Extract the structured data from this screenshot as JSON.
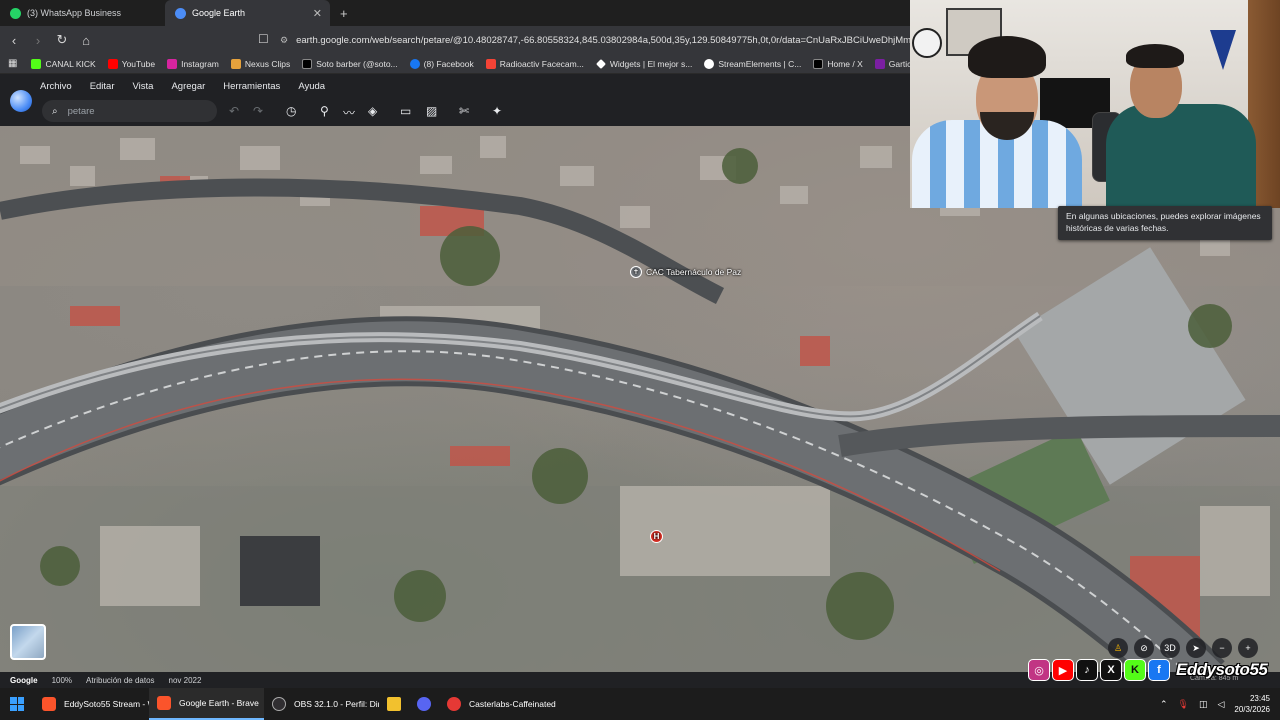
{
  "browser": {
    "tabs": [
      {
        "label": "(3) WhatsApp Business",
        "icon": "whatsapp-icon",
        "active": false
      },
      {
        "label": "Google Earth",
        "icon": "google-earth-icon",
        "active": true
      }
    ],
    "url": "earth.google.com/web/search/petare/@10.48028747,-66.80558324,845.03802984a,500d,35y,129.50849775h,0t,0r/data=CnUaRxJBCiUweDhjMm...",
    "bookmarks": [
      {
        "label": "CANAL KICK",
        "color": "#53fc18"
      },
      {
        "label": "YouTube",
        "color": "#ff0000"
      },
      {
        "label": "Instagram",
        "color": "#d6249f"
      },
      {
        "label": "Nexus Clips",
        "color": "#e6a23c"
      },
      {
        "label": "Soto barber (@soto...",
        "color": "#000000"
      },
      {
        "label": "(8) Facebook",
        "color": "#1877f2"
      },
      {
        "label": "Radioactiv Facecam...",
        "color": "#f44336"
      },
      {
        "label": "Widgets | El mejor s...",
        "color": "#ffffff"
      },
      {
        "label": "StreamElements | C...",
        "color": "#ffffff"
      },
      {
        "label": "Home / X",
        "color": "#000000"
      },
      {
        "label": "Gartic Phone - Tele",
        "color": "#7b1fa2"
      }
    ]
  },
  "earth": {
    "menu": [
      "Archivo",
      "Editar",
      "Vista",
      "Agregar",
      "Herramientas",
      "Ayuda"
    ],
    "search_placeholder": "petare",
    "poi_label": "CAC Tabernáculo de Paz",
    "tooltip": "En algunas ubicaciones, puedes explorar imágenes históricas de varias fechas.",
    "controls": {
      "three_d": "3D"
    },
    "status": {
      "brand": "Google",
      "zoom": "100%",
      "attribution": "Atribución de datos",
      "date": "nov 2022",
      "scale": "Cámara: 845 m"
    }
  },
  "stream": {
    "handle": "Eddysoto55",
    "socials": [
      {
        "name": "instagram-icon",
        "glyph": "◎",
        "color": "#c13584"
      },
      {
        "name": "youtube-icon",
        "glyph": "▶",
        "color": "#ff0000"
      },
      {
        "name": "tiktok-icon",
        "glyph": "♪",
        "color": "#000000"
      },
      {
        "name": "x-icon",
        "glyph": "X",
        "color": "#000000"
      },
      {
        "name": "kick-icon",
        "glyph": "K",
        "color": "#53fc18"
      },
      {
        "name": "facebook-icon",
        "glyph": "f",
        "color": "#1877f2"
      }
    ]
  },
  "taskbar": {
    "apps": [
      {
        "label": "EddySoto55 Stream - W",
        "color": "#fb542b",
        "active": false
      },
      {
        "label": "Google Earth - Brave",
        "color": "#fb542b",
        "active": true
      },
      {
        "label": "OBS 32.1.0 - Perfil: Direc",
        "color": "#302e31",
        "active": false
      },
      {
        "label": "",
        "color": "#f2c12e",
        "active": false
      },
      {
        "label": "",
        "color": "#5865f2",
        "active": false
      },
      {
        "label": "Casterlabs-Caffeinated",
        "color": "#e53935",
        "active": false
      }
    ],
    "time": "23:45",
    "date": "20/3/2026"
  }
}
